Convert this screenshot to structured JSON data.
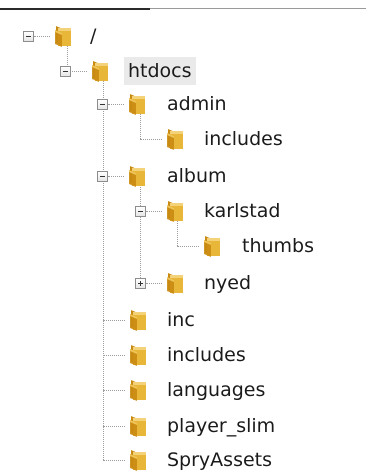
{
  "tree": {
    "nodes": [
      {
        "id": "root",
        "label": "/",
        "expanded": true
      },
      {
        "id": "htdocs",
        "label": "htdocs",
        "expanded": true,
        "selected": true
      },
      {
        "id": "admin",
        "label": "admin",
        "expanded": true
      },
      {
        "id": "admin-includes",
        "label": "includes"
      },
      {
        "id": "album",
        "label": "album",
        "expanded": true
      },
      {
        "id": "karlstad",
        "label": "karlstad",
        "expanded": true
      },
      {
        "id": "thumbs",
        "label": "thumbs"
      },
      {
        "id": "nyed",
        "label": "nyed",
        "expanded": false
      },
      {
        "id": "inc",
        "label": "inc"
      },
      {
        "id": "includes",
        "label": "includes"
      },
      {
        "id": "languages",
        "label": "languages"
      },
      {
        "id": "player-slim",
        "label": "player_slim"
      },
      {
        "id": "spryassets",
        "label": "SpryAssets"
      }
    ]
  },
  "icons": {
    "folder": "folder-icon",
    "expand": "plus-box-icon",
    "collapse": "minus-box-icon"
  },
  "colors": {
    "folder": "#e8b73a",
    "folder_dark": "#c98a12",
    "selection": "#eaeaea"
  }
}
